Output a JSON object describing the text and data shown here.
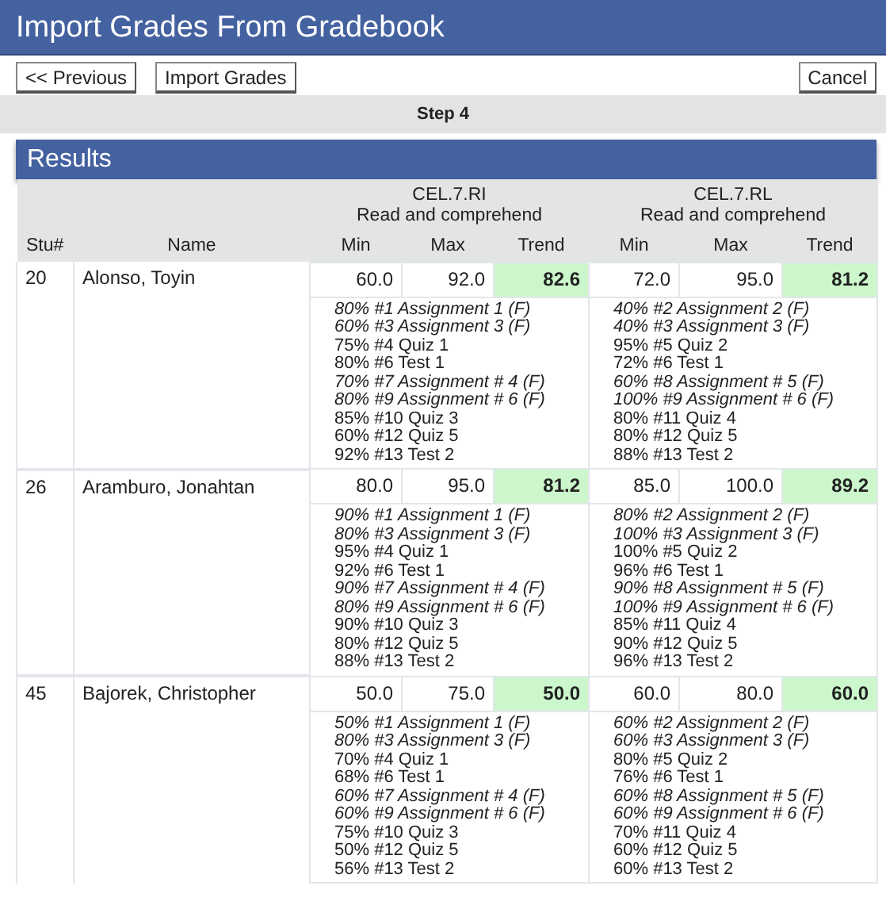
{
  "window": {
    "title": "Import Grades From Gradebook"
  },
  "toolbar": {
    "left_buttons": [
      "<< Previous",
      "Import Grades"
    ],
    "right_buttons": [
      "Cancel"
    ]
  },
  "step": "Step 4",
  "results": {
    "title": "Results",
    "standards": [
      {
        "code": "CEL.7.RI",
        "description": "Read and comprehend"
      },
      {
        "code": "CEL.7.RL",
        "description": "Read and comprehend"
      }
    ],
    "columns": [
      "Stu#",
      "Name",
      "Min",
      "Max",
      "Trend",
      "Min",
      "Max",
      "Trend"
    ],
    "rows": [
      {
        "stu": "20",
        "name": "Alonso, Toyin",
        "scores": [
          {
            "min": "60.0",
            "max": "92.0",
            "trend": "82.6",
            "details": [
              {
                "text": "80% #1 Assignment 1 (F)",
                "formative": true
              },
              {
                "text": "60% #3 Assignment 3 (F)",
                "formative": true
              },
              {
                "text": "75% #4 Quiz 1",
                "formative": false
              },
              {
                "text": "80% #6 Test 1",
                "formative": false
              },
              {
                "text": "70% #7 Assignment # 4 (F)",
                "formative": true
              },
              {
                "text": "80% #9 Assignment # 6 (F)",
                "formative": true
              },
              {
                "text": "85% #10 Quiz 3",
                "formative": false
              },
              {
                "text": "60% #12 Quiz 5",
                "formative": false
              },
              {
                "text": "92% #13 Test 2",
                "formative": false
              }
            ]
          },
          {
            "min": "72.0",
            "max": "95.0",
            "trend": "81.2",
            "details": [
              {
                "text": "40% #2 Assignment 2 (F)",
                "formative": true
              },
              {
                "text": "40% #3 Assignment 3 (F)",
                "formative": true
              },
              {
                "text": "95% #5 Quiz 2",
                "formative": false
              },
              {
                "text": "72% #6 Test 1",
                "formative": false
              },
              {
                "text": "60% #8 Assignment # 5 (F)",
                "formative": true
              },
              {
                "text": "100% #9 Assignment # 6 (F)",
                "formative": true
              },
              {
                "text": "80% #11 Quiz 4",
                "formative": false
              },
              {
                "text": "80% #12 Quiz 5",
                "formative": false
              },
              {
                "text": "88% #13 Test 2",
                "formative": false
              }
            ]
          }
        ]
      },
      {
        "stu": "26",
        "name": "Aramburo, Jonahtan",
        "scores": [
          {
            "min": "80.0",
            "max": "95.0",
            "trend": "81.2",
            "details": [
              {
                "text": "90% #1 Assignment 1 (F)",
                "formative": true
              },
              {
                "text": "80% #3 Assignment 3 (F)",
                "formative": true
              },
              {
                "text": "95% #4 Quiz 1",
                "formative": false
              },
              {
                "text": "92% #6 Test 1",
                "formative": false
              },
              {
                "text": "90% #7 Assignment # 4 (F)",
                "formative": true
              },
              {
                "text": "80% #9 Assignment # 6 (F)",
                "formative": true
              },
              {
                "text": "90% #10 Quiz 3",
                "formative": false
              },
              {
                "text": "80% #12 Quiz 5",
                "formative": false
              },
              {
                "text": "88% #13 Test 2",
                "formative": false
              }
            ]
          },
          {
            "min": "85.0",
            "max": "100.0",
            "trend": "89.2",
            "details": [
              {
                "text": "80% #2 Assignment 2 (F)",
                "formative": true
              },
              {
                "text": "100% #3 Assignment 3 (F)",
                "formative": true
              },
              {
                "text": "100% #5 Quiz 2",
                "formative": false
              },
              {
                "text": "96% #6 Test 1",
                "formative": false
              },
              {
                "text": "90% #8 Assignment # 5 (F)",
                "formative": true
              },
              {
                "text": "100% #9 Assignment # 6 (F)",
                "formative": true
              },
              {
                "text": "85% #11 Quiz 4",
                "formative": false
              },
              {
                "text": "90% #12 Quiz 5",
                "formative": false
              },
              {
                "text": "96% #13 Test 2",
                "formative": false
              }
            ]
          }
        ]
      },
      {
        "stu": "45",
        "name": "Bajorek, Christopher",
        "scores": [
          {
            "min": "50.0",
            "max": "75.0",
            "trend": "50.0",
            "details": [
              {
                "text": "50% #1 Assignment 1 (F)",
                "formative": true
              },
              {
                "text": "80% #3 Assignment 3 (F)",
                "formative": true
              },
              {
                "text": "70% #4 Quiz 1",
                "formative": false
              },
              {
                "text": "68% #6 Test 1",
                "formative": false
              },
              {
                "text": "60% #7 Assignment # 4 (F)",
                "formative": true
              },
              {
                "text": "60% #9 Assignment # 6 (F)",
                "formative": true
              },
              {
                "text": "75% #10 Quiz 3",
                "formative": false
              },
              {
                "text": "50% #12 Quiz 5",
                "formative": false
              },
              {
                "text": "56% #13 Test 2",
                "formative": false
              }
            ]
          },
          {
            "min": "60.0",
            "max": "80.0",
            "trend": "60.0",
            "details": [
              {
                "text": "60% #2 Assignment 2 (F)",
                "formative": true
              },
              {
                "text": "60% #3 Assignment 3 (F)",
                "formative": true
              },
              {
                "text": "80% #5 Quiz 2",
                "formative": false
              },
              {
                "text": "76% #6 Test 1",
                "formative": false
              },
              {
                "text": "60% #8 Assignment # 5 (F)",
                "formative": true
              },
              {
                "text": "60% #9 Assignment # 6 (F)",
                "formative": true
              },
              {
                "text": "70% #11 Quiz 4",
                "formative": false
              },
              {
                "text": "60% #12 Quiz 5",
                "formative": false
              },
              {
                "text": "60% #13 Test 2",
                "formative": false
              }
            ]
          }
        ]
      }
    ]
  }
}
